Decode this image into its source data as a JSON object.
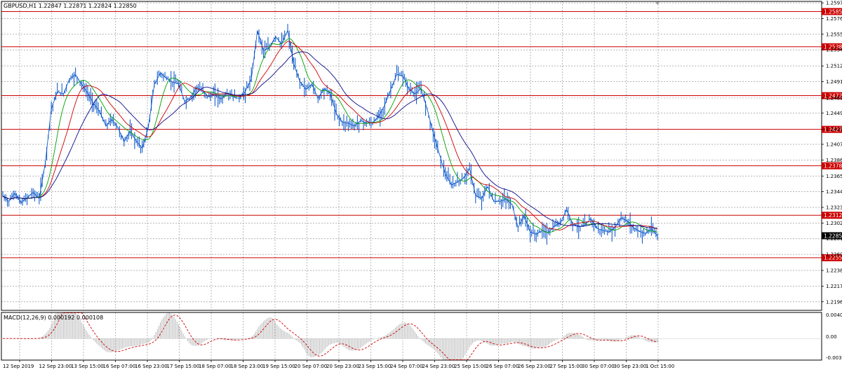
{
  "title": "GBPUSD,H1  1.22847 1.22871 1.22824 1.22850",
  "macd_label": "MACD(12,26,9) 0.000192 0.000108",
  "chart_data": [
    {
      "type": "candlestick",
      "symbol": "GBPUSD",
      "timeframe": "H1",
      "ohlc_last": [
        1.22847,
        1.22871,
        1.22824,
        1.2285
      ],
      "current_price": "1.22850",
      "ylim": [
        1.2185,
        1.2599
      ],
      "y_ticks": [
        "1.25970",
        "1.25760",
        "1.25550",
        "1.25340",
        "1.25125",
        "1.24915",
        "1.24695",
        "1.24495",
        "1.24275",
        "1.24075",
        "1.23865",
        "1.23650",
        "1.23440",
        "1.23230",
        "1.23020",
        "1.22810",
        "1.22600",
        "1.22385",
        "1.22175",
        "1.21965"
      ],
      "x_ticks": [
        "12 Sep 2019",
        "12 Sep 23:00",
        "13 Sep 15:00",
        "16 Sep 07:00",
        "16 Sep 23:00",
        "17 Sep 15:00",
        "18 Sep 07:00",
        "18 Sep 23:00",
        "19 Sep 15:00",
        "20 Sep 07:00",
        "20 Sep 23:00",
        "23 Sep 15:00",
        "24 Sep 07:00",
        "24 Sep 23:00",
        "25 Sep 15:00",
        "26 Sep 07:00",
        "26 Sep 23:00",
        "27 Sep 15:00",
        "30 Sep 07:00",
        "30 Sep 23:00",
        "1 Oct 15:00"
      ],
      "price_path": [
        1.2338,
        1.2331,
        1.2342,
        1.2329,
        1.2336,
        1.2343,
        1.2335,
        1.2382,
        1.2455,
        1.2478,
        1.2475,
        1.2495,
        1.2501,
        1.2488,
        1.2476,
        1.2462,
        1.2451,
        1.2432,
        1.2441,
        1.243,
        1.2411,
        1.2425,
        1.2412,
        1.2402,
        1.243,
        1.2488,
        1.2503,
        1.2496,
        1.2491,
        1.2488,
        1.2465,
        1.247,
        1.2484,
        1.2479,
        1.2471,
        1.2475,
        1.2468,
        1.2476,
        1.2471,
        1.2469,
        1.2478,
        1.2495,
        1.256,
        1.2533,
        1.2537,
        1.2552,
        1.2542,
        1.256,
        1.2515,
        1.2492,
        1.2481,
        1.2488,
        1.2469,
        1.2482,
        1.2476,
        1.2449,
        1.2437,
        1.2436,
        1.2432,
        1.2439,
        1.2436,
        1.2436,
        1.2445,
        1.246,
        1.2481,
        1.2501,
        1.2499,
        1.2482,
        1.2475,
        1.2482,
        1.2455,
        1.2423,
        1.2395,
        1.2368,
        1.2353,
        1.2357,
        1.2362,
        1.2375,
        1.2339,
        1.2335,
        1.2351,
        1.2331,
        1.2331,
        1.2334,
        1.2327,
        1.2296,
        1.2312,
        1.229,
        1.2287,
        1.2292,
        1.2289,
        1.2298,
        1.2302,
        1.232,
        1.2301,
        1.2297,
        1.2299,
        1.2308,
        1.2295,
        1.2292,
        1.229,
        1.2296,
        1.2309,
        1.2305,
        1.2296,
        1.2291,
        1.2288,
        1.2294,
        1.2285
      ],
      "horizontal_levels": [
        "1.25854",
        "1.25382",
        "1.24727",
        "1.24275",
        "1.23787",
        "1.23124",
        "1.22555"
      ],
      "level_color": "#cc0000",
      "series_colors": {
        "price": "#0050c8",
        "ma_fast": "#00a000",
        "ma_mid": "#cc0000",
        "ma_slow": "#0a0a8a"
      }
    },
    {
      "type": "histogram",
      "indicator": "MACD(12,26,9)",
      "values": [
        "0.000192",
        "0.000108"
      ],
      "ylim": [
        -0.00336,
        0.00407
      ],
      "y_ticks": [
        "0.004077",
        "0.00",
        "-0.00336"
      ],
      "signal_color": "#cc0000",
      "hist_color": "#b0b0b0"
    }
  ]
}
